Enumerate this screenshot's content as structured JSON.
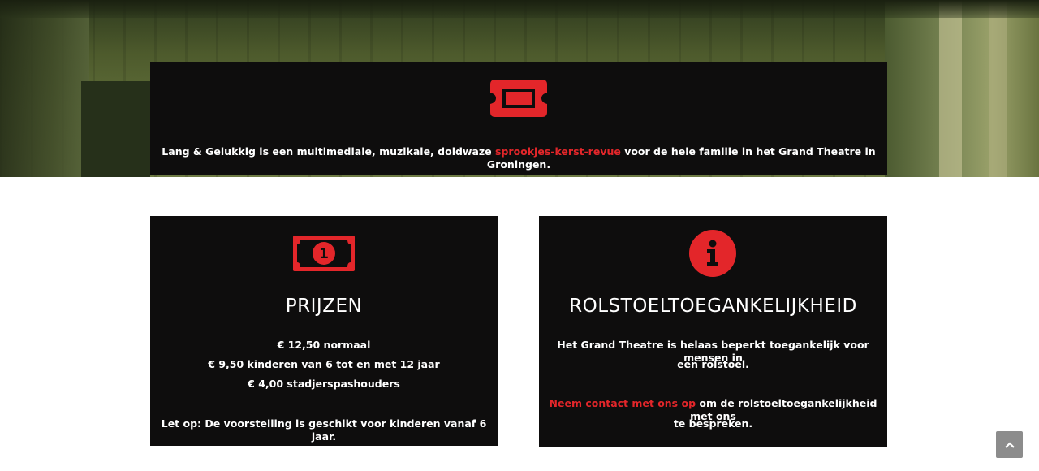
{
  "hero": {
    "intro_before": "Lang & Gelukkig is een multimediale, muzikale, doldwaze ",
    "intro_link": "sprookjes-kerst-revue",
    "intro_after": " voor de hele familie in het Grand Theatre in Groningen.",
    "icon": "ticket-icon"
  },
  "prices": {
    "icon": "money-bill-icon",
    "title": "PRIJZEN",
    "lines": [
      "€ 12,50 normaal",
      "€ 9,50 kinderen van 6 tot en met 12 jaar",
      "€ 4,00 stadjerspashouders"
    ],
    "note": "Let op: De voorstelling is geschikt voor kinderen vanaf 6 jaar."
  },
  "accessibility": {
    "icon": "info-icon",
    "title": "ROLSTOELTOEGANKELIJKHEID",
    "text_line1": "Het Grand Theatre is helaas beperkt toegankelijk voor mensen in",
    "text_line2": "een rolstoel.",
    "contact_link": "Neem contact met ons op",
    "contact_after_1": " om de rolstoeltoegankelijkheid met ons",
    "contact_after_2": "te bespreken."
  },
  "scroll_top": {
    "icon": "chevron-up-icon"
  },
  "colors": {
    "accent": "#e3262a",
    "card_bg": "#0e0d0d",
    "scroll_button": "#8c8c8c"
  }
}
